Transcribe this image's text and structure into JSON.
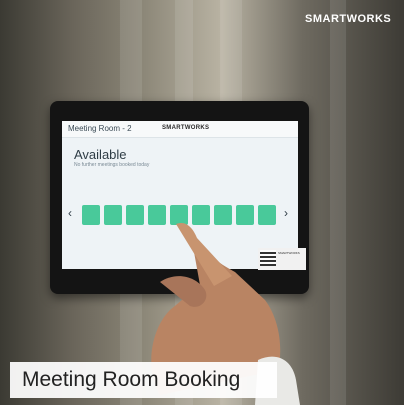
{
  "watermark": "SMARTWORKS",
  "tablet": {
    "room_name": "Meeting Room - 2",
    "brand": "SMARTWORKS",
    "status": "Available",
    "status_detail": "No further meetings booked today",
    "prev_arrow": "‹",
    "next_arrow": "›"
  },
  "qr_label": "SMARTWORKS",
  "caption": "Meeting Room Booking",
  "colors": {
    "slot": "#49c99a",
    "screen": "#eef3f6"
  }
}
